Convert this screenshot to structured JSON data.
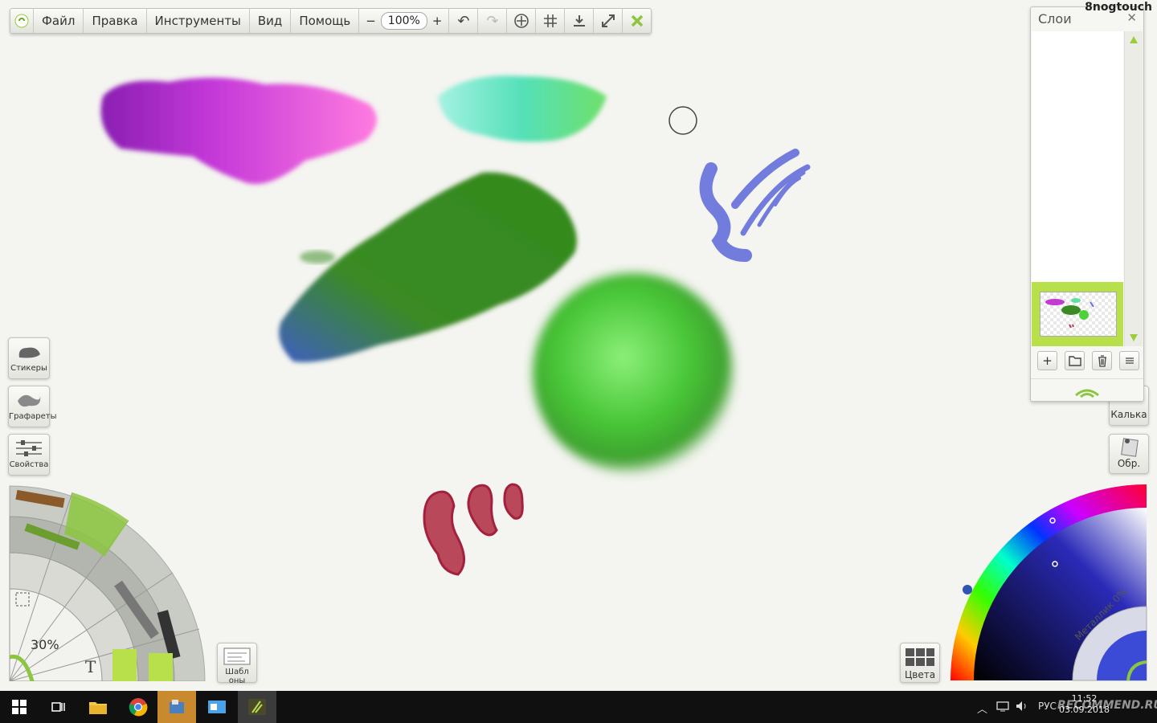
{
  "toolbar": {
    "menu": [
      "Файл",
      "Правка",
      "Инструменты",
      "Вид",
      "Помощь"
    ],
    "zoom_minus": "−",
    "zoom_value": "100%",
    "zoom_plus": "+",
    "icons": [
      "undo-icon",
      "redo-icon",
      "compass-icon",
      "grid-icon",
      "download-icon",
      "fullscreen-icon",
      "close-icon"
    ]
  },
  "left_buttons": {
    "stickers": "Стикеры",
    "stencils": "Графареты",
    "properties": "Свойства"
  },
  "tool_wheel": {
    "size": "30%",
    "text_tool": "T"
  },
  "templates_button": "Шабл оны",
  "colors_button": "Цвета",
  "layers_panel": {
    "title": "Слои",
    "close": "✕",
    "buttons": [
      "+",
      "folder-icon",
      "trash-icon",
      "menu-icon"
    ]
  },
  "right_buttons": {
    "tracing": "Калька",
    "refs": "Обр."
  },
  "color_wheel": {
    "metallic": "Металлик 0%"
  },
  "watermark": "8nogtouch",
  "taskbar": {
    "lang": "РУС",
    "time": "11:52",
    "date": "03.09.2018",
    "recommend": "RECOMMEND.RU"
  },
  "colors": {
    "accent": "#b8e04a",
    "purple": "#b33bd6",
    "pink": "#ff6fd8",
    "teal": "#7fe8cf",
    "green_stroke": "#3a8a1f",
    "blue_stroke": "#3c5fb8",
    "blob_green": "#4fd13a",
    "blue_scribble": "#6b77df",
    "red_marks": "#b8404f"
  }
}
